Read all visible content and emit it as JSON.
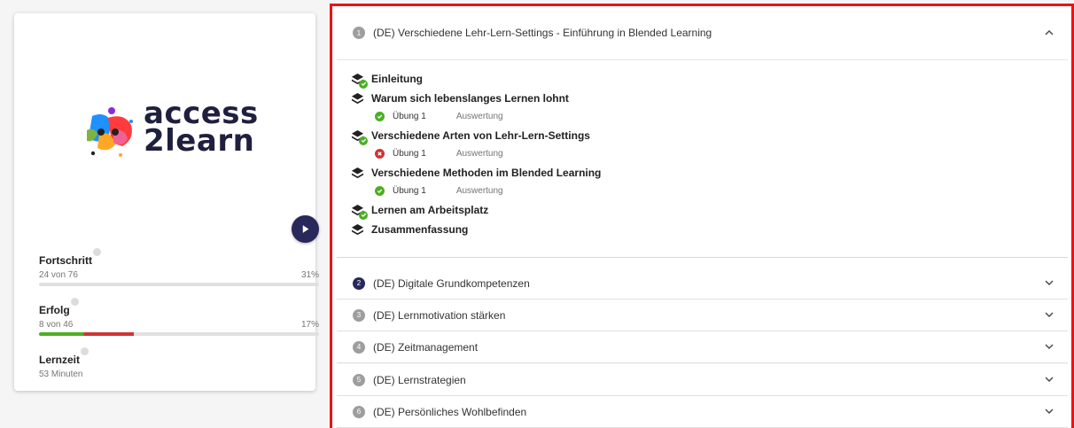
{
  "brand": {
    "line1": "access",
    "line2": "2learn"
  },
  "stats": [
    {
      "label": "Fortschritt",
      "left": "24 von 76",
      "right": "31%",
      "value": 0.31,
      "colors": [
        "#c9c9c9"
      ]
    },
    {
      "label": "Erfolg",
      "left": "8 von 46",
      "right": "17%",
      "value": 0.17,
      "colors": [
        "#4caf24",
        "#d23232"
      ]
    },
    {
      "label": "Lernzeit",
      "left": "53 Minuten",
      "right": ""
    }
  ],
  "sections": [
    {
      "num": "1",
      "title": "(DE) Verschiedene Lehr-Lern-Settings - Einführung in Blended Learning",
      "expanded": true,
      "lessons": [
        {
          "title": "Einleitung",
          "done": true
        },
        {
          "title": "Warum sich lebenslanges Lernen lohnt",
          "done": false,
          "exercise": {
            "label": "Übung 1",
            "eval": "Auswertung",
            "status": "passed"
          }
        },
        {
          "title": "Verschiedene Arten von Lehr-Lern-Settings",
          "done": true,
          "exercise": {
            "label": "Übung 1",
            "eval": "Auswertung",
            "status": "failed"
          }
        },
        {
          "title": "Verschiedene Methoden im Blended Learning",
          "done": false,
          "exercise": {
            "label": "Übung 1",
            "eval": "Auswertung",
            "status": "passed"
          }
        },
        {
          "title": "Lernen am Arbeitsplatz",
          "done": true
        },
        {
          "title": "Zusammenfassung",
          "done": false
        }
      ]
    },
    {
      "num": "2",
      "title": "(DE) Digitale Grundkompetenzen",
      "current": true
    },
    {
      "num": "3",
      "title": "(DE) Lernmotivation stärken"
    },
    {
      "num": "4",
      "title": "(DE) Zeitmanagement"
    },
    {
      "num": "5",
      "title": "(DE) Lernstrategien"
    },
    {
      "num": "6",
      "title": "(DE) Persönliches Wohlbefinden"
    }
  ],
  "colors": {
    "accent": "#28285a",
    "success": "#4caf24",
    "error": "#d23232",
    "highlight_border": "#ee1111"
  },
  "icons": {
    "play": "play-icon",
    "expand": "chevron-down-icon",
    "collapse": "chevron-up-icon",
    "lesson": "layers-icon",
    "passed": "check-circle-icon",
    "failed": "x-circle-icon",
    "info": "info-icon"
  }
}
